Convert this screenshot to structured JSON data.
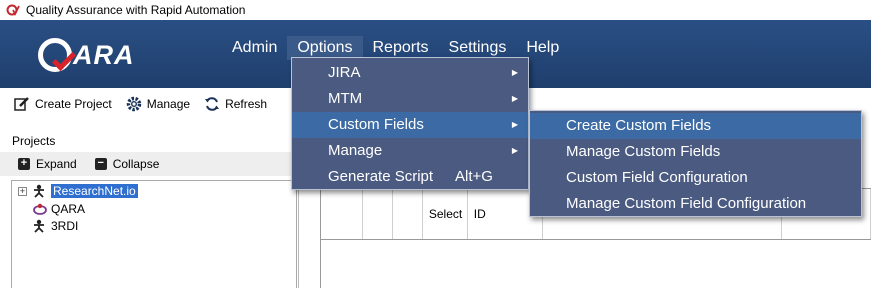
{
  "window": {
    "title": "Quality Assurance with Rapid Automation",
    "icon": "qv-app-icon"
  },
  "header": {
    "logo_text": "ARA",
    "logo_icon": "qara-logo-q-check"
  },
  "menubar": [
    {
      "label": "Admin"
    },
    {
      "label": "Options",
      "open": true
    },
    {
      "label": "Reports"
    },
    {
      "label": "Settings"
    },
    {
      "label": "Help"
    }
  ],
  "toolbar": {
    "create_project": "Create Project",
    "manage": "Manage",
    "refresh": "Refresh"
  },
  "projects": {
    "label": "Projects",
    "expand": "Expand",
    "collapse": "Collapse",
    "items": [
      {
        "label": "ResearchNet.io",
        "selected": true
      },
      {
        "label": "QARA"
      },
      {
        "label": "3RDI"
      }
    ]
  },
  "options_menu": {
    "items": [
      {
        "label": "JIRA",
        "submenu": true
      },
      {
        "label": "MTM",
        "submenu": true
      },
      {
        "label": "Custom Fields",
        "submenu": true,
        "highlighted": true
      },
      {
        "label": "Manage",
        "submenu": true
      },
      {
        "label": "Generate Script",
        "shortcut": "Alt+G"
      }
    ]
  },
  "custom_fields_submenu": {
    "items": [
      {
        "label": "Create Custom Fields",
        "highlighted": true
      },
      {
        "label": "Manage Custom Fields"
      },
      {
        "label": "Custom Field Configuration"
      },
      {
        "label": "Manage Custom Field Configuration"
      }
    ]
  },
  "grid": {
    "columns": [
      "",
      "",
      "",
      "Select",
      "ID",
      "",
      ""
    ]
  },
  "colors": {
    "header_bg": "#2a4f84",
    "menu_bg": "#4a5a80",
    "menu_highlight": "#3b6aa4",
    "selection": "#2f6fd0",
    "logo_check": "#d8232a"
  }
}
